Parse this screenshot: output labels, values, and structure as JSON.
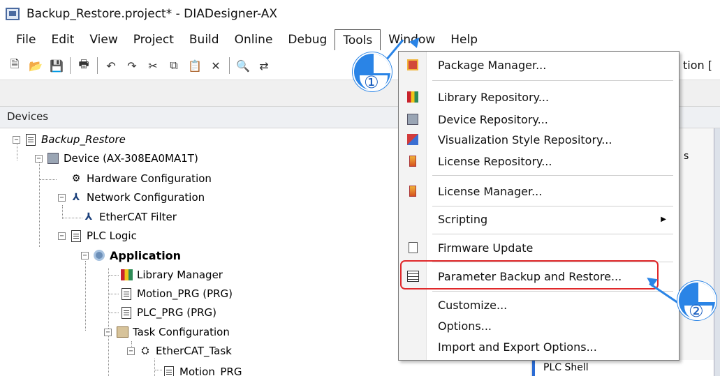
{
  "window": {
    "title": "Backup_Restore.project* - DIADesigner-AX"
  },
  "menubar": [
    "File",
    "Edit",
    "View",
    "Project",
    "Build",
    "Online",
    "Debug",
    "Tools",
    "Window",
    "Help"
  ],
  "toolbar": {
    "right_text": "tion ["
  },
  "devices_panel": {
    "title": "Devices",
    "tree": [
      {
        "label": "Backup_Restore",
        "icon": "project-icon"
      },
      {
        "label": "Device (AX-308EA0MA1T)",
        "icon": "device-icon"
      },
      {
        "label": "Hardware Configuration",
        "icon": "hardware-config-icon"
      },
      {
        "label": "Network Configuration",
        "icon": "network-icon"
      },
      {
        "label": "EtherCAT Filter",
        "icon": "network-icon"
      },
      {
        "label": "PLC Logic",
        "icon": "plc-logic-icon"
      },
      {
        "label": "Application",
        "icon": "gear-icon"
      },
      {
        "label": "Library Manager",
        "icon": "library-icon"
      },
      {
        "label": "Motion_PRG (PRG)",
        "icon": "document-icon"
      },
      {
        "label": "PLC_PRG (PRG)",
        "icon": "document-icon"
      },
      {
        "label": "Task Configuration",
        "icon": "task-config-icon"
      },
      {
        "label": "EtherCAT_Task",
        "icon": "task-icon"
      },
      {
        "label": "Motion_PRG",
        "icon": "program-call-icon"
      }
    ]
  },
  "background": {
    "right_fragment": "s",
    "plc_shell": "PLC Shell"
  },
  "tools_menu": {
    "items": [
      {
        "label": "Package Manager...",
        "icon": "package-icon"
      },
      {
        "label": "Library Repository...",
        "icon": "library-icon"
      },
      {
        "label": "Device Repository...",
        "icon": "device-icon"
      },
      {
        "label": "Visualization Style Repository...",
        "icon": "visualization-icon"
      },
      {
        "label": "License Repository...",
        "icon": "license-icon"
      },
      {
        "label": "License Manager...",
        "icon": "license-icon"
      },
      {
        "label": "Scripting",
        "icon": "",
        "submenu": true
      },
      {
        "label": "Firmware Update",
        "icon": "firmware-icon"
      },
      {
        "label": "Parameter Backup and Restore...",
        "icon": "backup-icon"
      },
      {
        "label": "Customize...",
        "icon": ""
      },
      {
        "label": "Options...",
        "icon": ""
      },
      {
        "label": "Import and Export Options...",
        "icon": ""
      }
    ]
  },
  "callouts": [
    "①",
    "②"
  ],
  "colors": {
    "callout": "#2a84e6",
    "highlight": "#e0282a"
  }
}
